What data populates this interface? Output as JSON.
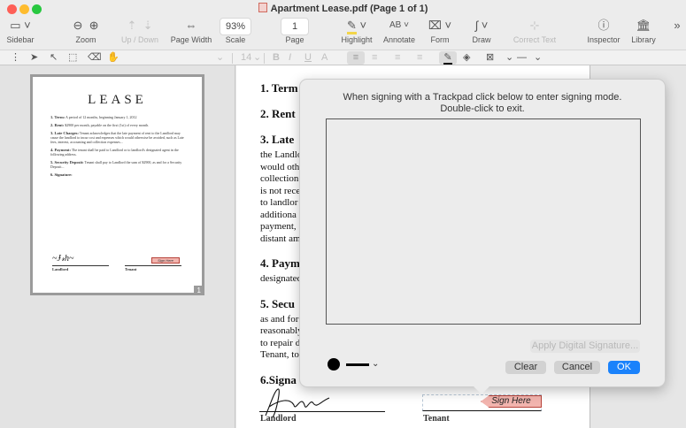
{
  "window": {
    "title": "Apartment Lease.pdf (Page 1 of 1)",
    "traffic_colors": [
      "#fe5f57",
      "#febc2e",
      "#28c840"
    ]
  },
  "toolbar": {
    "sidebar": "Sidebar",
    "zoom": "Zoom",
    "updown": "Up / Down",
    "pagewidth": "Page Width",
    "scale_value": "93%",
    "scale": "Scale",
    "page_value": "1",
    "page": "Page",
    "highlight": "Highlight",
    "annotate_ic": "AB",
    "annotate": "Annotate",
    "form": "Form",
    "draw": "Draw",
    "correct_text": "Correct Text",
    "inspector": "Inspector",
    "library": "Library"
  },
  "formatbar": {
    "font_size": "14",
    "bold": "B",
    "italic": "I",
    "underline": "U",
    "text_style": "A"
  },
  "thumbnail": {
    "title": "LEASE",
    "lines": [
      {
        "b": "1. Term:",
        "t": " A period of 12 months, beginning January 1, 2012"
      },
      {
        "b": "2. Rent:",
        "t": " $2900 per month, payable on the first (1st) of every month."
      },
      {
        "b": "3. Late Charges:",
        "t": " Tenant acknowledges that the late payment of rent to the Landlord may cause the landlord to incur cost and expenses which would otherwise be avoided, such as Late fees, interest, accounting and collection expenses..."
      },
      {
        "b": "4. Payment:",
        "t": " The tenant shall be paid to Landlord or to landlord's designated agent in the following address."
      },
      {
        "b": "5. Security Deposit:",
        "t": " Tenant shall pay to Landlord the sum of $2900, as and for a Security Deposit..."
      },
      {
        "b": "6. Signature:",
        "t": ""
      }
    ],
    "landlord": "Landlord",
    "tenant": "Tenant",
    "sign_here": "Sign Here",
    "page_number": "1"
  },
  "document": {
    "h1": "1. Term",
    "h2": "2. Rent",
    "h3": "3. Late",
    "p3": [
      "the Landlo",
      "would oth",
      "collection",
      "is not rece",
      "to landlor",
      "additiona",
      "payment,",
      "distant am"
    ],
    "h4": "4. Paym",
    "p4": [
      "designated"
    ],
    "h5": "5. Secu",
    "p5": [
      "as and for",
      "reasonably",
      "to repair d",
      "Tenant, to"
    ],
    "h6": "6.Signa",
    "landlord": "Landlord",
    "tenant": "Tenant",
    "sign_here": "Sign Here"
  },
  "popover": {
    "instruction_1": "When signing with a Trackpad click below to enter signing mode.",
    "instruction_2": "Double-click to exit.",
    "apply": "Apply Digital Signature...",
    "clear": "Clear",
    "cancel": "Cancel",
    "ok": "OK",
    "accent": "#1a82fb"
  }
}
